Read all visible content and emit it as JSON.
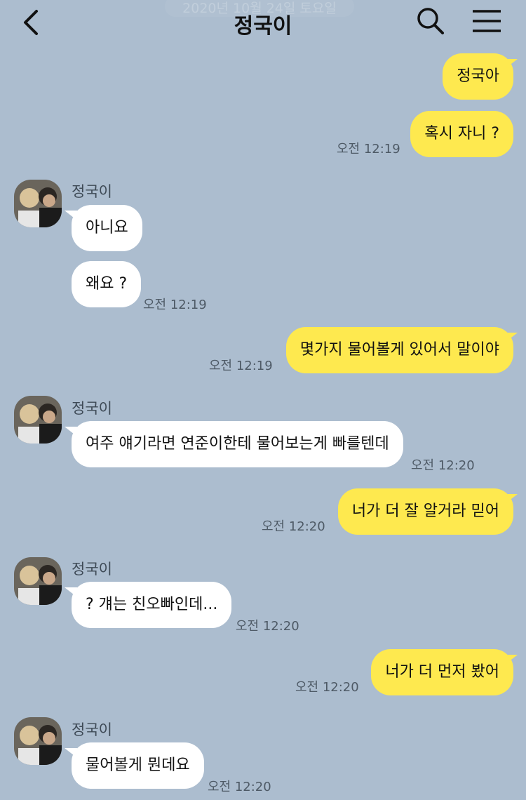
{
  "header": {
    "date": "2020년 10월 24일 토요일",
    "title": "정국이"
  },
  "contact": {
    "name": "정국이"
  },
  "messages": [
    {
      "side": "me",
      "text": "정국아"
    },
    {
      "side": "me",
      "text": "혹시 자니 ?",
      "time": "오전 12:19"
    },
    {
      "side": "you",
      "text": "아니요"
    },
    {
      "side": "you",
      "text": "왜요 ?",
      "time": "오전 12:19"
    },
    {
      "side": "me",
      "text": "몇가지 물어볼게 있어서 말이야",
      "time": "오전 12:19"
    },
    {
      "side": "you",
      "text": "여주 얘기라면 연준이한테 물어보는게 빠를텐데",
      "time": "오전 12:20"
    },
    {
      "side": "me",
      "text": "너가 더 잘 알거라 믿어",
      "time": "오전 12:20"
    },
    {
      "side": "you",
      "text": "? 걔는 친오빠인데...",
      "time": "오전 12:20"
    },
    {
      "side": "me",
      "text": "너가 더 먼저 봤어",
      "time": "오전 12:20"
    },
    {
      "side": "you",
      "text": "물어볼게 뭔데요",
      "time": "오전 12:20"
    }
  ],
  "colors": {
    "background": "#acbdcf",
    "my_bubble": "#fee94f",
    "their_bubble": "#ffffff"
  },
  "icons": [
    "back-arrow-icon",
    "search-icon",
    "hamburger-menu-icon",
    "profile-photo"
  ]
}
